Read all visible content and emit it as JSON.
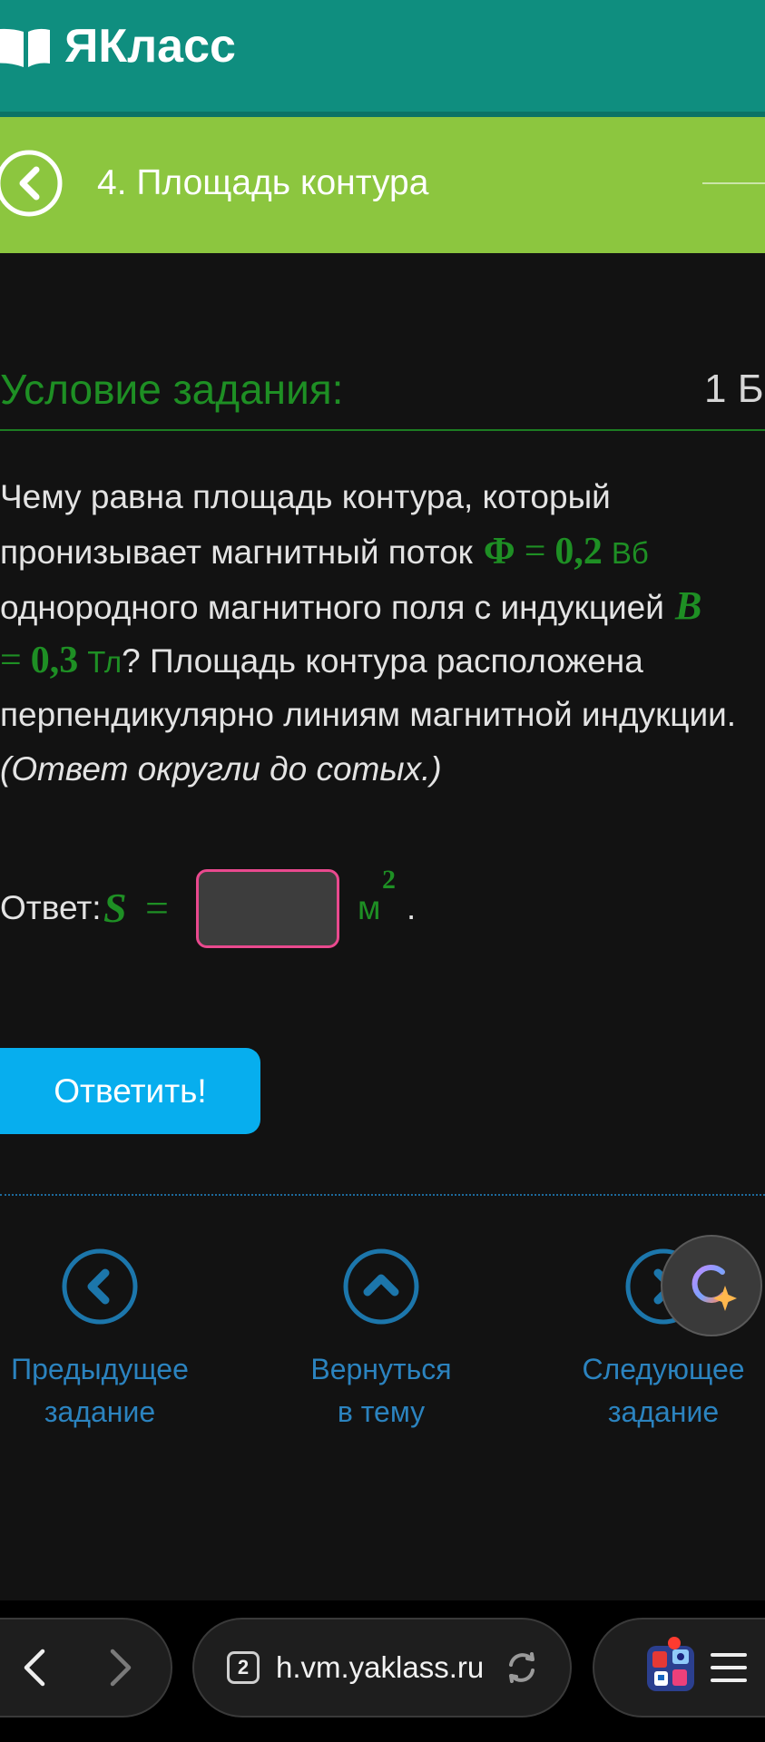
{
  "header": {
    "logo": "ЯКласс"
  },
  "topic": {
    "title": "4. Площадь контура"
  },
  "task": {
    "heading": "Условие задания:",
    "points": "1 Б"
  },
  "question": {
    "line1": "Чему равна площадь контура, который",
    "line2": "пронизывает магнитный поток",
    "flux_symbol": "Φ",
    "equals": "=",
    "flux_value": "0,2",
    "flux_unit": "Вб",
    "line3": "однородного магнитного поля с индукцией",
    "induction_symbol": "B",
    "induction_value": "0,3",
    "induction_unit": "Тл",
    "line4": "? Площадь контура расположена",
    "line5": "перпендикулярно линиям магнитной индукции.",
    "hint": "(Ответ округли до сотых.)"
  },
  "answer": {
    "label": "Ответ:",
    "variable": "S",
    "equals": "=",
    "value": "",
    "unit": "м",
    "unit_power": "2",
    "period": "."
  },
  "submit": {
    "label": "Ответить!"
  },
  "nav": {
    "items": [
      {
        "line1": "Предыдущее",
        "line2": "задание",
        "icon": "chevron-left-circle-icon"
      },
      {
        "line1": "Вернуться",
        "line2": "в тему",
        "icon": "chevron-up-circle-icon"
      },
      {
        "line1": "Следующее",
        "line2": "задание",
        "icon": "chevron-right-circle-icon"
      }
    ]
  },
  "browser": {
    "tab_count": "2",
    "url": "h.vm.yaklass.ru"
  },
  "icons": {
    "logo": "book-icon",
    "topic_back": "back-circle-icon",
    "assistant": "ai-assistant-icon",
    "browser_back": "back-arrow-icon",
    "browser_forward": "forward-arrow-icon",
    "reload": "reload-icon",
    "menu": "hamburger-menu-icon"
  },
  "colors": {
    "header_teal": "#0f8e7f",
    "topic_green": "#8cc63f",
    "accent_green": "#1e8f24",
    "submit_blue": "#07aeee",
    "nav_blue": "#2b83bf",
    "input_border": "#e9498e",
    "background": "#121212"
  }
}
